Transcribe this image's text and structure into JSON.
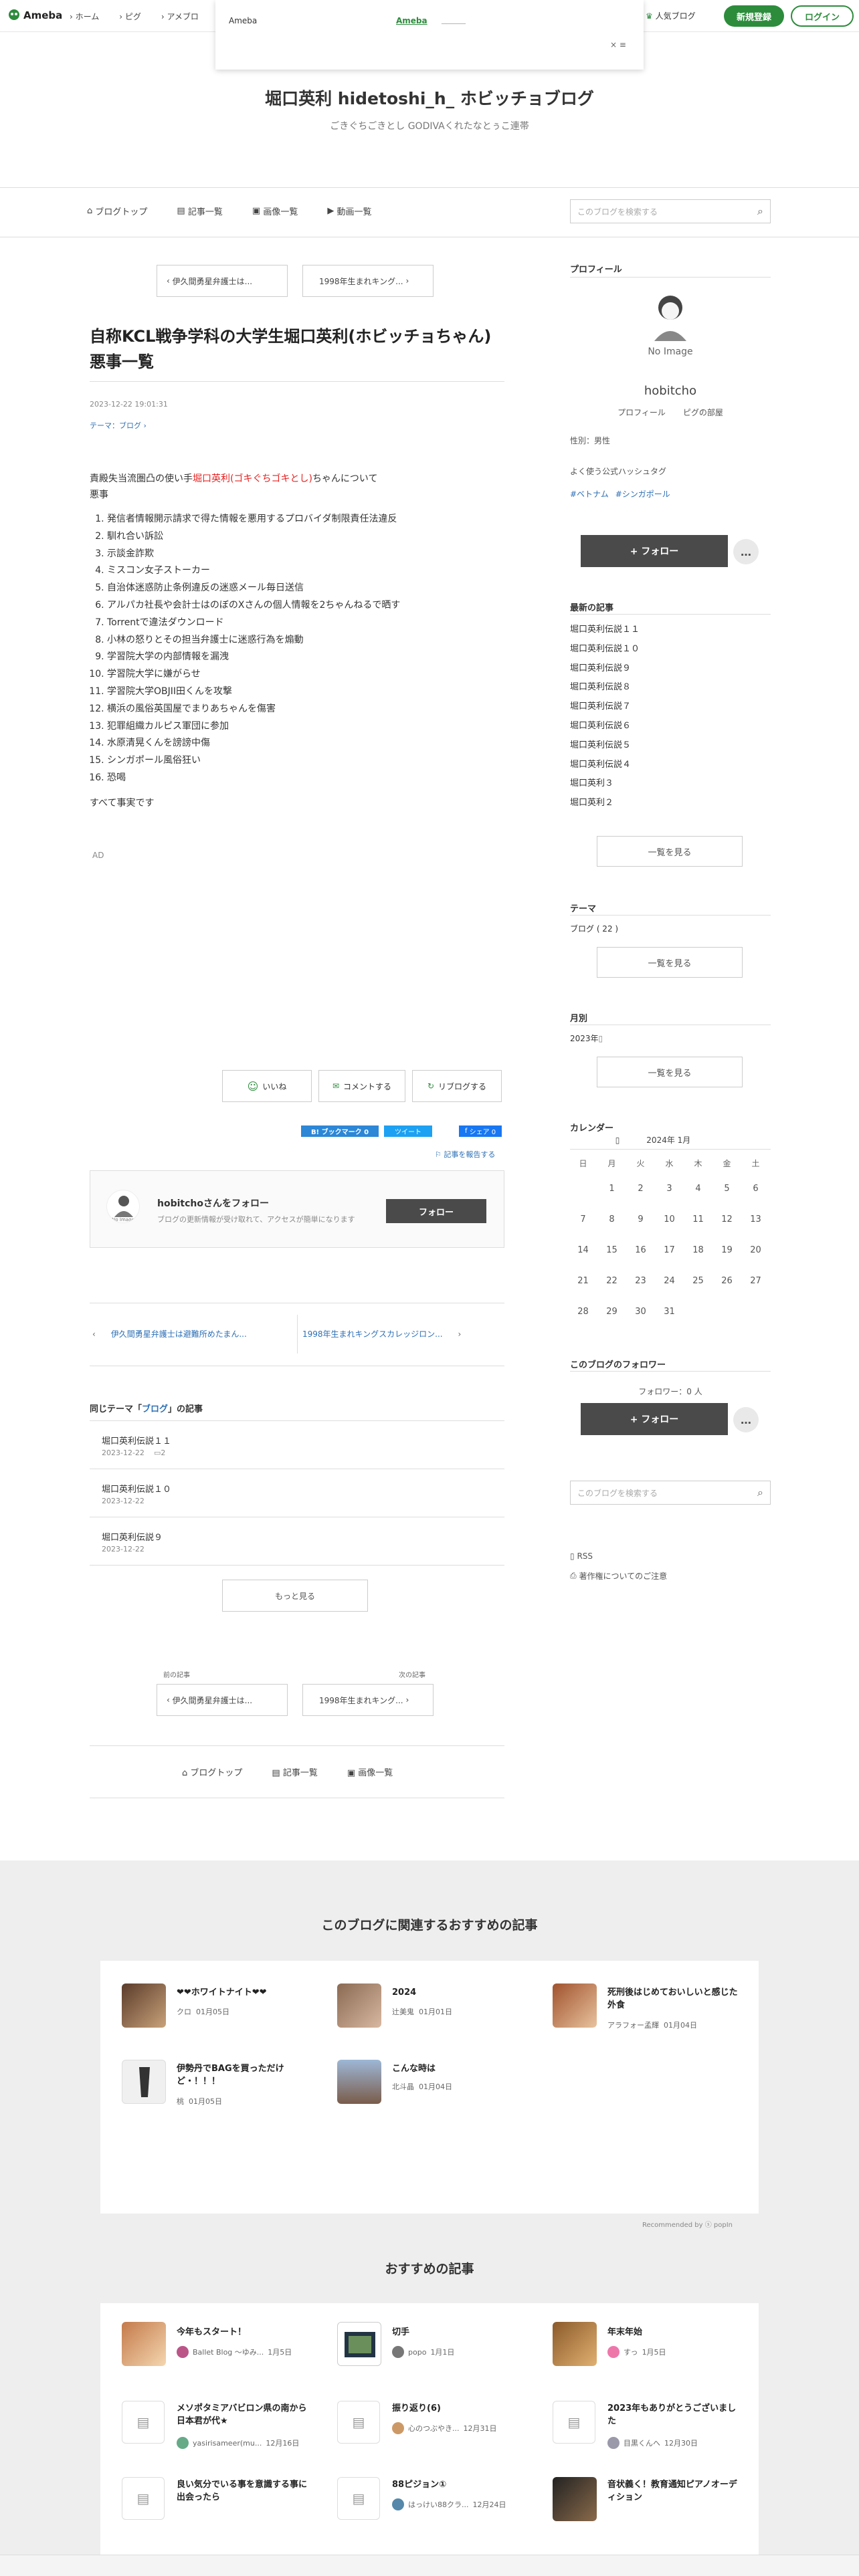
{
  "header": {
    "logo": "Ameba",
    "nav": [
      "ホーム",
      "ピグ",
      "アメブロ"
    ],
    "popular": "人気ブログ",
    "register": "新規登録",
    "login": "ログイン",
    "popup": {
      "left": "Ameba",
      "link": "Ameba",
      "underline": "______",
      "close": "× ≡"
    }
  },
  "blog": {
    "title": "堀口英利 hidetoshi_h_ ホビッチョブログ",
    "subtitle": "ごきぐちごきとし GODIVAくれたなとぅこ連帯"
  },
  "tabs": {
    "top": "ブログトップ",
    "list": "記事一覧",
    "images": "画像一覧",
    "videos": "動画一覧",
    "search_placeholder": "このブログを検索する"
  },
  "prevnext_top": {
    "prev": "伊久間勇星弁護士は...",
    "next": "1998年生まれキング..."
  },
  "article": {
    "title": "自称KCL戦争学科の大学生堀口英利(ホビッチョちゃん)悪事一覧",
    "date": "2023-12-22 19:01:31",
    "theme": "テーマ：ブログ ›",
    "intro_a": "責殿失当流圏凸の使い手",
    "intro_red": "堀口英利(ゴキぐちゴキとし)",
    "intro_b": "ちゃんについて",
    "intro_2": "悪事",
    "items": [
      "発信者情報開示請求で得た情報を悪用するプロバイダ制限責任法違反",
      "馴れ合い訴訟",
      "示談金詐欺",
      "ミスコン女子ストーカー",
      "自治体迷惑防止条例違反の迷惑メール毎日送信",
      "アルパカ社長や会計士はのぼのXさんの個人情報を2ちゃんねるで晒す",
      "Torrentで違法ダウンロード",
      "小林の怒りとその担当弁護士に迷惑行為を煽動",
      "学習院大学の内部情報を漏洩",
      "学習院大学に嫌がらせ",
      "学習院大学OBJII田くんを攻撃",
      "横浜の風俗英国屋でまりあちゃんを傷害",
      "犯罪組織カルピス軍団に参加",
      "水原清晃くんを謗謗中傷",
      "シンガポール風俗狂い",
      "恐喝"
    ],
    "footer": "すべて事実です",
    "ad": "AD"
  },
  "actions": {
    "like": "いいね",
    "comment": "コメントする",
    "reblog": "リブログする",
    "hatena": "B! ブックマーク 0",
    "tweet": "ツイート",
    "share": "シェア 0",
    "report": "記事を報告する"
  },
  "follow_box": {
    "title": "hobitchoさんをフォロー",
    "desc": "ブログの更新情報が受け取れて、アクセスが簡単になります",
    "button": "フォロー",
    "avatar": "No Image"
  },
  "nav_bottom": {
    "prev": "伊久間勇星弁護士は避難所めたまん...",
    "next": "1998年生まれキングスカレッジロン..."
  },
  "same_theme": {
    "heading_a": "同じテーマ「",
    "heading_link": "ブログ",
    "heading_b": "」の記事",
    "items": [
      {
        "title": "堀口英利伝説１１",
        "date": "2023-12-22",
        "count": "2"
      },
      {
        "title": "堀口英利伝説１０",
        "date": "2023-12-22"
      },
      {
        "title": "堀口英利伝説９",
        "date": "2023-12-22"
      }
    ],
    "more": "もっと見る"
  },
  "prevnext_bottom": {
    "prev_label": "前の記事",
    "next_label": "次の記事",
    "prev": "伊久間勇星弁護士は...",
    "next": "1998年生まれキング..."
  },
  "footer_tabs": {
    "top": "ブログトップ",
    "list": "記事一覧",
    "images": "画像一覧"
  },
  "sidebar": {
    "profile_h": "プロフィール",
    "avatar": "No Image",
    "name": "hobitcho",
    "profile_link": "プロフィール",
    "room_link": "ピグの部屋",
    "gender": "性別：男性",
    "hashtag_h": "よく使う公式ハッシュタグ",
    "hashtags": [
      "#ベトナム",
      "#シンガポール"
    ],
    "follow": "+ フォロー",
    "more": "…",
    "recent_h": "最新の記事",
    "recent": [
      "堀口英利伝説１１",
      "堀口英利伝説１０",
      "堀口英利伝説９",
      "堀口英利伝説８",
      "堀口英利伝説７",
      "堀口英利伝説６",
      "堀口英利伝説５",
      "堀口英利伝説４",
      "堀口英利３",
      "堀口英利２"
    ],
    "list_more": "一覧を見る",
    "theme_h": "テーマ",
    "theme_item": "ブログ ( 22 )",
    "month_h": "月別",
    "month_item": "2023年",
    "cal_h": "カレンダー",
    "cal_month": "2024年 1月",
    "cal_days": [
      "日",
      "月",
      "火",
      "水",
      "木",
      "金",
      "土"
    ],
    "cal_weeks": [
      [
        "",
        "1",
        "2",
        "3",
        "4",
        "5",
        "6"
      ],
      [
        "7",
        "8",
        "9",
        "10",
        "11",
        "12",
        "13"
      ],
      [
        "14",
        "15",
        "16",
        "17",
        "18",
        "19",
        "20"
      ],
      [
        "21",
        "22",
        "23",
        "24",
        "25",
        "26",
        "27"
      ],
      [
        "28",
        "29",
        "30",
        "31",
        "",
        "",
        ""
      ]
    ],
    "followers_h": "このブログのフォロワー",
    "followers": "フォロワー：0 人",
    "search_placeholder": "このブログを検索する",
    "rss": "RSS",
    "copyright": "著作権についてのご注意"
  },
  "related": {
    "heading": "このブログに関連するおすすめの記事",
    "items": [
      {
        "title": "❤❤ホワイトナイト❤❤",
        "author": "クロ",
        "date": "01月05日"
      },
      {
        "title": "2024",
        "author": "辻美鬼",
        "date": "01月01日"
      },
      {
        "title": "死刑後はじめておいしいと感じた外食",
        "author": "アラフォー孟輝",
        "date": "01月04日"
      },
      {
        "title": "伊勢丹でBAGを買っただけど・！！！",
        "author": "桃",
        "date": "01月05日"
      },
      {
        "title": "こんな時は",
        "author": "北斗晶",
        "date": "01月04日"
      }
    ],
    "recommended": "Recommended by  ⓢ popIn"
  },
  "recommend": {
    "heading": "おすすめの記事",
    "items": [
      {
        "title": "今年もスタート！",
        "author": "Ballet Blog ～ゆみ...",
        "date": "1月5日"
      },
      {
        "title": "切手",
        "author": "popo",
        "date": "1月1日"
      },
      {
        "title": "年末年始",
        "author": "すっ",
        "date": "1月5日"
      },
      {
        "title": "メソポタミアバビロン県の南から日本君が代★",
        "author": "yasirisameer(mu...",
        "date": "12月16日"
      },
      {
        "title": "振り返り(6)",
        "author": "心のつぶやき...",
        "date": "12月31日"
      },
      {
        "title": "2023年もありがとうございました",
        "author": "目黒くんへ",
        "date": "12月30日"
      },
      {
        "title": "良い気分でいる事を意識する事に出会ったら",
        "author": "",
        "date": ""
      },
      {
        "title": "88ピジョン①",
        "author": "はっけい88クラ...",
        "date": "12月24日"
      },
      {
        "title": "音状義く！教育通知ピアノオーディション",
        "author": "",
        "date": ""
      }
    ]
  }
}
